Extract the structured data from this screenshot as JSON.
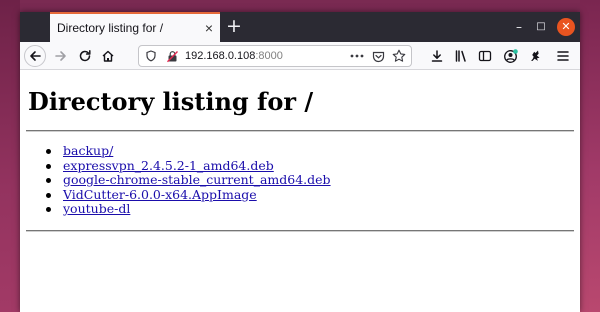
{
  "browser": {
    "tab": {
      "title": "Directory listing for /",
      "close_glyph": "×"
    },
    "new_tab_glyph": "+",
    "window_controls": {
      "minimize": "–",
      "maximize": "□",
      "close": "✕"
    },
    "url": {
      "host": "192.168.0.108",
      "port": ":8000"
    },
    "toolbar_icons": [
      "back-icon",
      "forward-icon",
      "reload-icon",
      "home-icon",
      "shield-icon",
      "insecure-lock-icon",
      "more-dots-icon",
      "pocket-icon",
      "bookmark-star-icon",
      "downloads-icon",
      "library-icon",
      "sidebar-icon",
      "account-icon",
      "extension-icon",
      "menu-icon"
    ],
    "colors": {
      "titlebar": "#2b2a33",
      "tab_accent": "#e66a3a",
      "close_button": "#e95420",
      "link": "#1a0dab"
    }
  },
  "page": {
    "heading": "Directory listing for /",
    "entries": [
      "backup/",
      "expressvpn_2.4.5.2-1_amd64.deb",
      "google-chrome-stable_current_amd64.deb",
      "VidCutter-6.0.0-x64.AppImage",
      "youtube-dl"
    ]
  }
}
